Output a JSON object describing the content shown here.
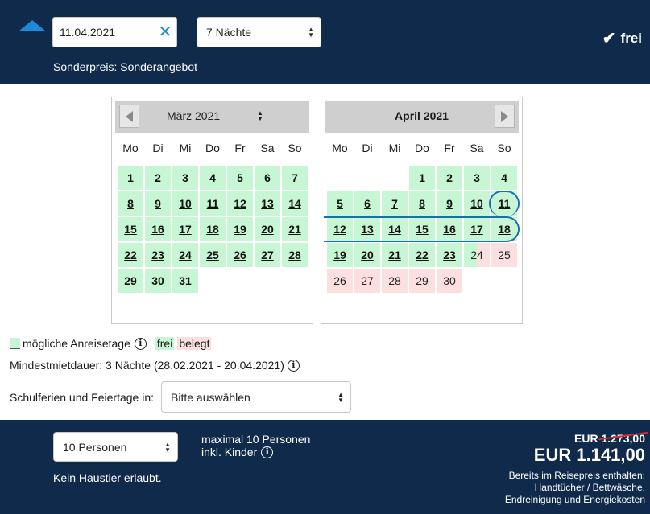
{
  "header": {
    "arrival_date": "11.04.2021",
    "nights_selected": "7 Nächte",
    "status": "frei",
    "special_price": "Sonderpreis: Sonderangebot"
  },
  "calendar_left": {
    "month": "März 2021",
    "weekdays": [
      "Mo",
      "Di",
      "Mi",
      "Do",
      "Fr",
      "Sa",
      "So"
    ],
    "first_weekday_index": 0,
    "days": [
      "1",
      "2",
      "3",
      "4",
      "5",
      "6",
      "7",
      "8",
      "9",
      "10",
      "11",
      "12",
      "13",
      "14",
      "15",
      "16",
      "17",
      "18",
      "19",
      "20",
      "21",
      "22",
      "23",
      "24",
      "25",
      "26",
      "27",
      "28",
      "29",
      "30",
      "31"
    ],
    "free_until": 31,
    "half_day": null,
    "booked_from": 32
  },
  "calendar_right": {
    "month": "April 2021",
    "weekdays": [
      "Mo",
      "Di",
      "Mi",
      "Do",
      "Fr",
      "Sa",
      "So"
    ],
    "first_weekday_index": 3,
    "days": [
      "1",
      "2",
      "3",
      "4",
      "5",
      "6",
      "7",
      "8",
      "9",
      "10",
      "11",
      "12",
      "13",
      "14",
      "15",
      "16",
      "17",
      "18",
      "19",
      "20",
      "21",
      "22",
      "23",
      "24",
      "25",
      "26",
      "27",
      "28",
      "29",
      "30"
    ],
    "free_until": 23,
    "half_day": 24,
    "booked_from": 25,
    "selected_range": [
      "11",
      "18"
    ]
  },
  "legend": {
    "arrival_days": "mögliche Anreisetage",
    "free": "frei",
    "booked": "belegt",
    "min_stay": "Mindestmietdauer: 3 Nächte (28.02.2021 - 20.04.2021)"
  },
  "holidays": {
    "label": "Schulferien und Feiertage in:",
    "selected": "Bitte auswählen"
  },
  "footer": {
    "persons_selected": "10 Personen",
    "no_pets": "Kein Haustier erlaubt.",
    "max_persons_line1": "maximal 10 Personen",
    "max_persons_line2": "inkl. Kinder",
    "old_price": "EUR 1.273,00",
    "new_price": "EUR 1.141,00",
    "included_line1": "Bereits im Reisepreis enthalten:",
    "included_line2": "Handtücher / Bettwäsche,",
    "included_line3": "Endreinigung und Energiekosten"
  },
  "colors": {
    "navy": "#0f2a4a",
    "free": "#c7f6d4",
    "booked": "#fbe0df",
    "accent": "#1b8ad9",
    "selection": "#1a6fb0"
  }
}
